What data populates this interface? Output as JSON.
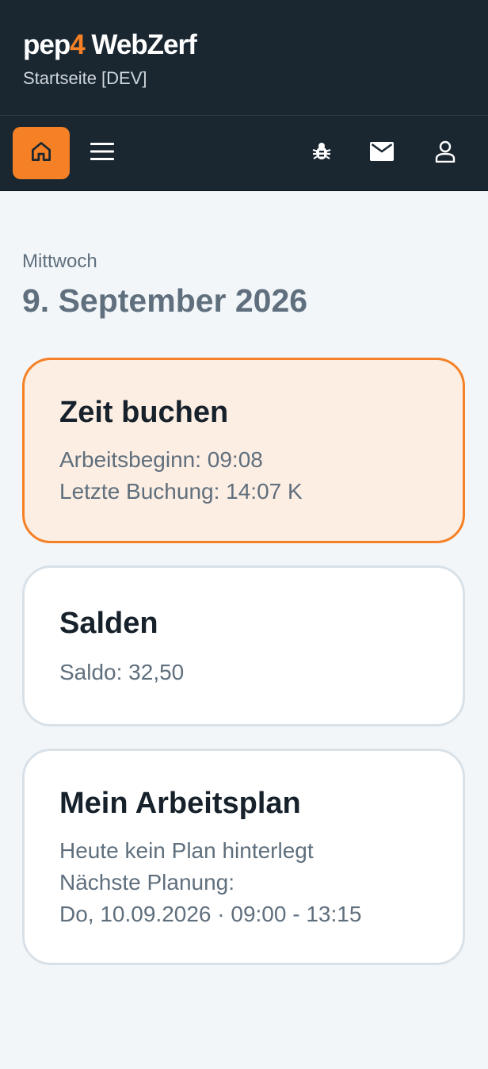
{
  "header": {
    "app_name_prefix": "pep",
    "app_name_accent": "4",
    "app_name_suffix": " WebZerf",
    "subtitle": "Startseite [DEV]"
  },
  "toolbar": {
    "home_icon": "home-icon",
    "menu_icon": "hamburger-menu-icon",
    "bug_icon": "bug-icon",
    "mail_icon": "mail-icon",
    "user_icon": "user-icon"
  },
  "date": {
    "weekday": "Mittwoch",
    "full_date": "9. September 2026"
  },
  "cards": {
    "time_booking": {
      "title": "Zeit buchen",
      "work_start": "Arbeitsbeginn: 09:08",
      "last_booking": "Letzte Buchung: 14:07 K"
    },
    "balances": {
      "title": "Salden",
      "balance": "Saldo: 32,50"
    },
    "work_schedule": {
      "title": "Mein Arbeitsplan",
      "today": "Heute kein Plan hinterlegt",
      "next_label": "Nächste Planung:",
      "next_value": "Do, 10.09.2026 · 09:00 - 13:15"
    }
  },
  "colors": {
    "header_bg": "#1a2731",
    "accent": "#f58025",
    "page_bg": "#f2f6f9",
    "highlight_card_bg": "#fdeee3",
    "card_border": "#d9e1e8",
    "muted_text": "#5f6f7d",
    "title_text": "#16212b"
  }
}
